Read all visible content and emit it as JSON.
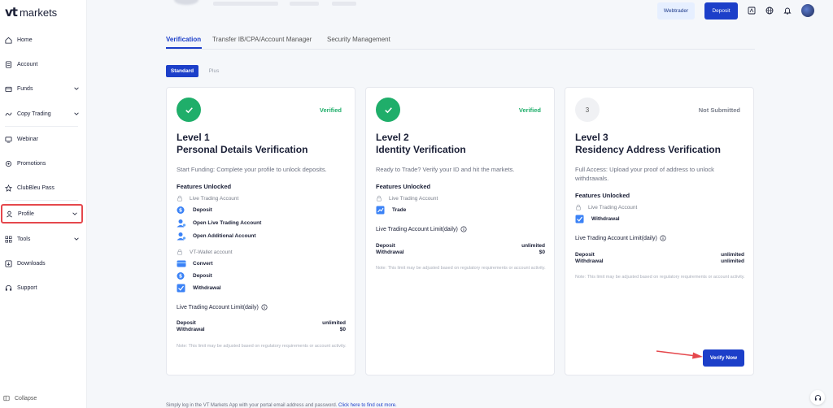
{
  "brand": {
    "logo_mark": "vt",
    "logo_text": "markets"
  },
  "sidebar": {
    "items": [
      {
        "label": "Home",
        "icon": "home-icon",
        "has_chevron": false
      },
      {
        "label": "Account",
        "icon": "account-icon",
        "has_chevron": false
      },
      {
        "label": "Funds",
        "icon": "funds-icon",
        "has_chevron": true
      },
      {
        "label": "Copy Trading",
        "icon": "copy-trading-icon",
        "has_chevron": true
      },
      {
        "label": "Webinar",
        "icon": "webinar-icon",
        "has_chevron": false
      },
      {
        "label": "Promotions",
        "icon": "promotions-icon",
        "has_chevron": false
      },
      {
        "label": "ClubBleu Pass",
        "icon": "clubbleu-icon",
        "has_chevron": false
      },
      {
        "label": "Profile",
        "icon": "profile-icon",
        "has_chevron": true,
        "active": true
      },
      {
        "label": "Tools",
        "icon": "tools-icon",
        "has_chevron": true
      },
      {
        "label": "Downloads",
        "icon": "downloads-icon",
        "has_chevron": false
      },
      {
        "label": "Support",
        "icon": "support-icon",
        "has_chevron": false
      }
    ],
    "collapse_label": "Collapse"
  },
  "header": {
    "webtrader_label": "Webtrader",
    "deposit_label": "Deposit",
    "icons": [
      "mt-icon",
      "globe-icon",
      "bell-icon"
    ]
  },
  "tabs": [
    {
      "label": "Verification",
      "active": true
    },
    {
      "label": "Transfer IB/CPA/Account Manager",
      "active": false
    },
    {
      "label": "Security Management",
      "active": false
    }
  ],
  "segments": {
    "standard": "Standard",
    "plus": "Plus"
  },
  "cards": [
    {
      "badge": "",
      "status": "Verified",
      "level": "Level 1",
      "title": "Personal Details Verification",
      "description": "Start Funding: Complete your profile to unlock deposits.",
      "features_title": "Features Unlocked",
      "groups": [
        {
          "name": "Live Trading Account",
          "features": [
            "Deposit",
            "Open Live Trading Account",
            "Open Additional Account"
          ]
        },
        {
          "name": "VT-Wallet account",
          "features": [
            "Convert",
            "Deposit",
            "Withdrawal"
          ]
        }
      ],
      "limit_title": "Live Trading Account Limit(daily)",
      "limits": [
        {
          "label": "Deposit",
          "value": "unlimited"
        },
        {
          "label": "Withdrawal",
          "value": "$0"
        }
      ],
      "note": "Note: This limit may be adjusted based on regulatory requirements or account activity."
    },
    {
      "badge": "",
      "status": "Verified",
      "level": "Level 2",
      "title": "Identity Verification",
      "description": "Ready to Trade? Verify your ID and hit the markets.",
      "features_title": "Features Unlocked",
      "groups": [
        {
          "name": "Live Trading Account",
          "features": [
            "Trade"
          ]
        }
      ],
      "limit_title": "Live Trading Account Limit(daily)",
      "limits": [
        {
          "label": "Deposit",
          "value": "unlimited"
        },
        {
          "label": "Withdrawal",
          "value": "$0"
        }
      ],
      "note": "Note: This limit may be adjusted based on regulatory requirements or account activity."
    },
    {
      "badge": "3",
      "status": "Not Submitted",
      "level": "Level 3",
      "title": "Residency Address Verification",
      "description": "Full Access: Upload your proof of address to unlock withdrawals.",
      "features_title": "Features Unlocked",
      "groups": [
        {
          "name": "Live Trading Account",
          "features": [
            "Withdrawal"
          ]
        }
      ],
      "limit_title": "Live Trading Account Limit(daily)",
      "limits": [
        {
          "label": "Deposit",
          "value": "unlimited"
        },
        {
          "label": "Withdrawal",
          "value": "unlimited"
        }
      ],
      "note": "Note: This limit may be adjusted based on regulatory requirements or account activity.",
      "action_label": "Verify Now"
    }
  ],
  "footer": {
    "text": "Simply log in the VT Markets App with your portal email address and password.",
    "link": "Click here to find out more."
  },
  "colors": {
    "primary": "#1c3fc9",
    "success": "#1fae6a",
    "highlight": "#e5484d"
  }
}
